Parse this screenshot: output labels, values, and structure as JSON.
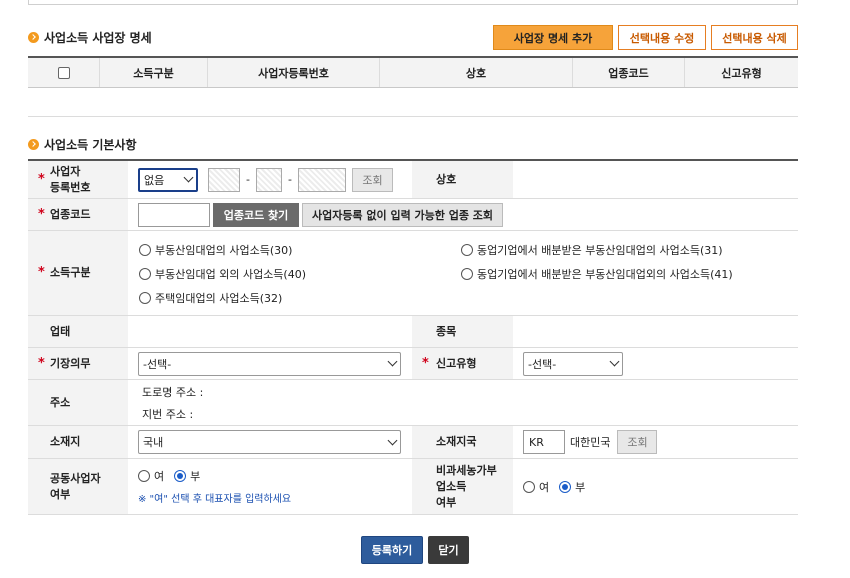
{
  "section1": {
    "title": "사업소득 사업장 명세",
    "add_button": "사업장 명세 추가",
    "edit_button": "선택내용 수정",
    "delete_button": "선택내용 삭제",
    "columns": [
      "소득구분",
      "사업자등록번호",
      "상호",
      "업종코드",
      "신고유형"
    ]
  },
  "section2": {
    "title": "사업소득 기본사항",
    "biz_reg": {
      "label": "사업자\n등록번호",
      "select_value": "없음",
      "dash": "-",
      "lookup_button": "조회"
    },
    "trade_name": {
      "label": "상호"
    },
    "industry_code": {
      "label": "업종코드",
      "find_button": "업종코드 찾기",
      "no_reg_button": "사업자등록 없이 입력 가능한 업종 조회"
    },
    "income_type": {
      "label": "소득구분",
      "options": [
        "부동산임대업의 사업소득(30)",
        "부동산임대업 외의 사업소득(40)",
        "주택임대업의 사업소득(32)",
        "동업기업에서 배분받은 부동산임대업의 사업소득(31)",
        "동업기업에서 배분받은 부동산임대업외의 사업소득(41)"
      ]
    },
    "business_type": {
      "label": "업태"
    },
    "item": {
      "label": "종목"
    },
    "bookkeeping": {
      "label": "기장의무",
      "value": "-선택-"
    },
    "report_type": {
      "label": "신고유형",
      "value": "-선택-"
    },
    "address": {
      "label": "주소",
      "road": "도로명 주소 :",
      "lot": "지번 주소 :"
    },
    "location": {
      "label": "소재지",
      "value": "국내"
    },
    "country": {
      "label": "소재지국",
      "code": "KR",
      "name": "대한민국",
      "lookup_button": "조회"
    },
    "joint": {
      "label": "공동사업자\n여부",
      "yes": "여",
      "no": "부",
      "selected": "부",
      "note": "※ \"여\" 선택 후 대표자를 입력하세요"
    },
    "tax_exempt": {
      "label": "비과세농가부\n업소득\n여부",
      "yes": "여",
      "no": "부",
      "selected": "부"
    }
  },
  "footer": {
    "submit": "등록하기",
    "close": "닫기"
  },
  "colors": {
    "accent_orange": "#f6a33a",
    "submit_blue": "#2e5c9c",
    "required": "#d0021b"
  }
}
